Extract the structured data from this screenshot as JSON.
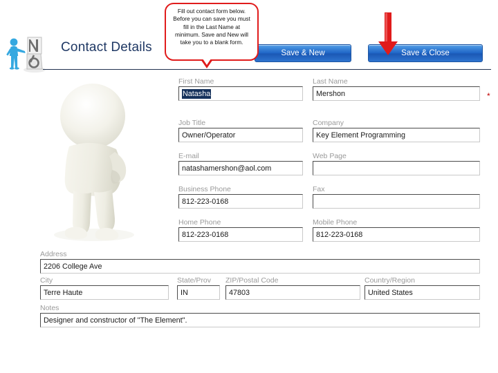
{
  "header": {
    "title": "Contact Details",
    "logo_icon": "blue-3d-person-with-letters-logo",
    "figure_icon": "white-3d-mannequin-figure"
  },
  "callout": {
    "text": "Fill out contact form below. Before you can save you must fill in the Last Name at minimum. Save and New will take you to a blank form.",
    "border_color": "#e01b1b"
  },
  "arrow": {
    "icon": "red-down-arrow",
    "color": "#e01b1b",
    "points_to": "Save & Close"
  },
  "toolbar": {
    "save_new_label": "Save & New",
    "save_close_label": "Save & Close",
    "button_color": "#1d62c4"
  },
  "form": {
    "required_marker": "*",
    "fields": [
      {
        "name": "first-name",
        "label": "First Name",
        "value": "Natasha",
        "selected": true
      },
      {
        "name": "last-name",
        "label": "Last Name",
        "value": "Mershon",
        "required": true
      },
      {
        "name": "job-title",
        "label": "Job Title",
        "value": "Owner/Operator"
      },
      {
        "name": "company",
        "label": "Company",
        "value": "Key Element Programming"
      },
      {
        "name": "email",
        "label": "E-mail",
        "value": "natashamershon@aol.com"
      },
      {
        "name": "web-page",
        "label": "Web Page",
        "value": ""
      },
      {
        "name": "business-phone",
        "label": "Business Phone",
        "value": "812-223-0168"
      },
      {
        "name": "fax",
        "label": "Fax",
        "value": ""
      },
      {
        "name": "home-phone",
        "label": "Home Phone",
        "value": "812-223-0168"
      },
      {
        "name": "mobile-phone",
        "label": "Mobile Phone",
        "value": "812-223-0168"
      },
      {
        "name": "address",
        "label": "Address",
        "value": "2206 College Ave"
      },
      {
        "name": "city",
        "label": "City",
        "value": "Terre Haute"
      },
      {
        "name": "state",
        "label": "State/Prov",
        "value": "IN"
      },
      {
        "name": "zip",
        "label": "ZIP/Postal Code",
        "value": "47803"
      },
      {
        "name": "country",
        "label": "Country/Region",
        "value": "United States"
      },
      {
        "name": "notes",
        "label": "Notes",
        "value": "Designer and constructor of \"The Element\"."
      }
    ]
  }
}
